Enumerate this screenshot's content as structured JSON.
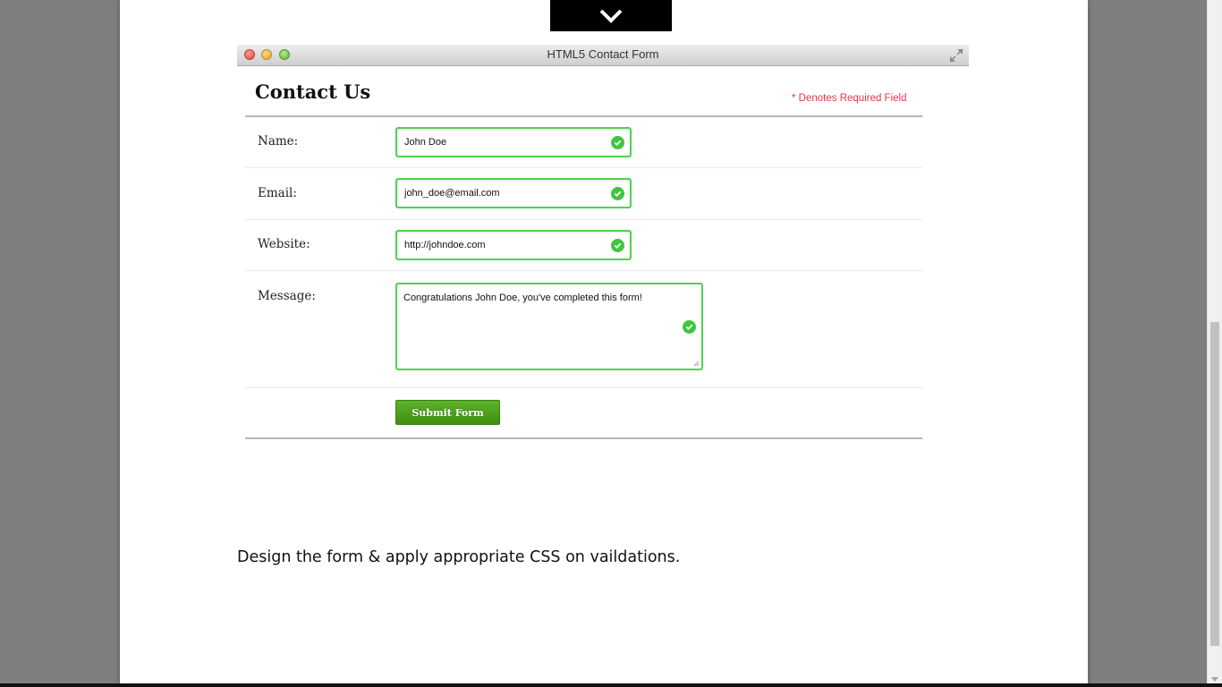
{
  "window": {
    "title": "HTML5 Contact Form"
  },
  "form": {
    "heading": "Contact Us",
    "required_note": "* Denotes Required Field",
    "fields": {
      "name": {
        "label": "Name:",
        "value": "John Doe"
      },
      "email": {
        "label": "Email:",
        "value": "john_doe@email.com"
      },
      "website": {
        "label": "Website:",
        "value": "http://johndoe.com"
      },
      "message": {
        "label": "Message:",
        "value": "Congratulations John Doe, you've completed this form!"
      }
    },
    "submit_label": "Submit Form",
    "valid_color": "#4ed44e"
  },
  "instruction": "Design the form & apply appropriate CSS on vaildations.",
  "icons": {
    "collapse": "chevron-down-icon",
    "valid": "check-circle-icon",
    "resize": "expand-icon"
  }
}
